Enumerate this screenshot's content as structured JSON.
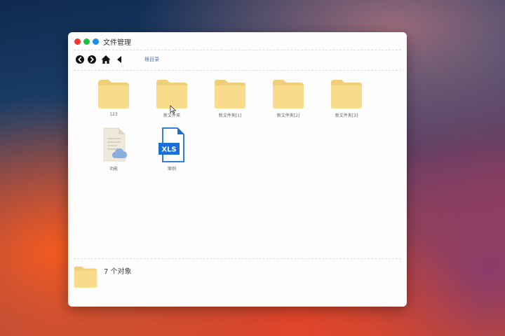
{
  "window": {
    "title": "文件管理"
  },
  "toolbar": {
    "back_icon": "chevron-left-circle-icon",
    "forward_icon": "chevron-right-circle-icon",
    "home_icon": "home-icon",
    "up_icon": "triangle-left-icon",
    "breadcrumb": "根目录"
  },
  "files": [
    {
      "name": "123",
      "type": "folder"
    },
    {
      "name": "新文件夹",
      "type": "folder"
    },
    {
      "name": "新文件夹[1]",
      "type": "folder"
    },
    {
      "name": "新文件夹[2]",
      "type": "folder"
    },
    {
      "name": "新文件夹[3]",
      "type": "folder"
    },
    {
      "name": "功能",
      "type": "cloud-document"
    },
    {
      "name": "案例",
      "type": "xls",
      "badge": "XLS"
    }
  ],
  "status": {
    "text": "7 个对象"
  },
  "colors": {
    "folder": "#f8dc8c",
    "folder_tab": "#f0cf78",
    "xls_blue": "#1a6fd8",
    "close": "#ee3b2f",
    "minimize": "#1cc23a",
    "maximize": "#1a8fe6",
    "breadcrumb": "#4a78c2"
  }
}
